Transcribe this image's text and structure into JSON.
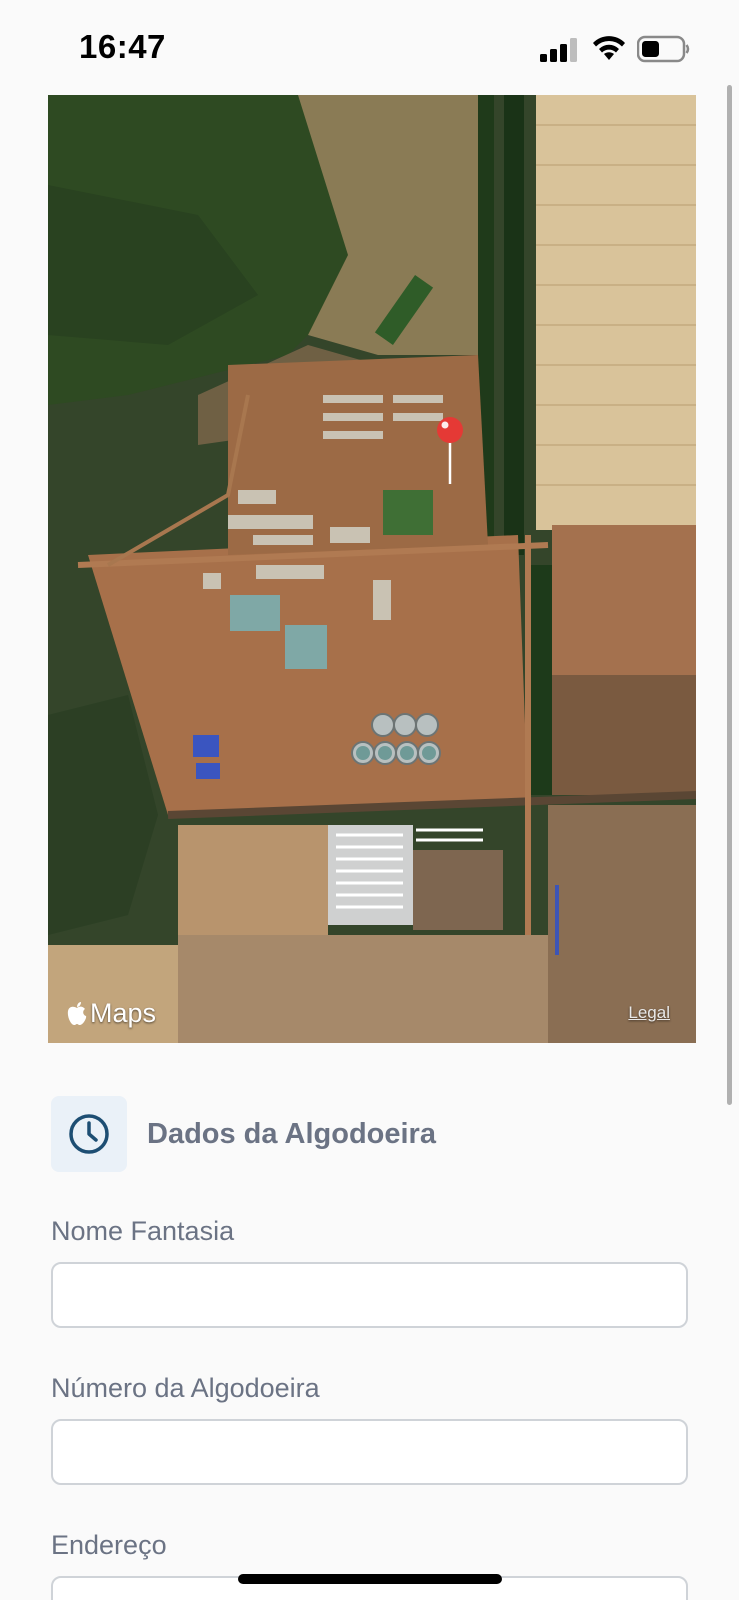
{
  "status_bar": {
    "time": "16:47",
    "icons": [
      "signal-icon",
      "wifi-icon",
      "battery-icon"
    ]
  },
  "map": {
    "logo_text": "Maps",
    "legal_link": "Legal",
    "pin_icon": "map-pin-icon",
    "pin_color": "#e53935"
  },
  "section": {
    "icon": "clock-icon",
    "title": "Dados da Algodoeira",
    "icon_color": "#1d4e73"
  },
  "form": {
    "fields": [
      {
        "label": "Nome Fantasia",
        "value": "",
        "placeholder": ""
      },
      {
        "label": "Número da Algodoeira",
        "value": "",
        "placeholder": ""
      },
      {
        "label": "Endereço",
        "value": "",
        "placeholder": ""
      }
    ]
  }
}
